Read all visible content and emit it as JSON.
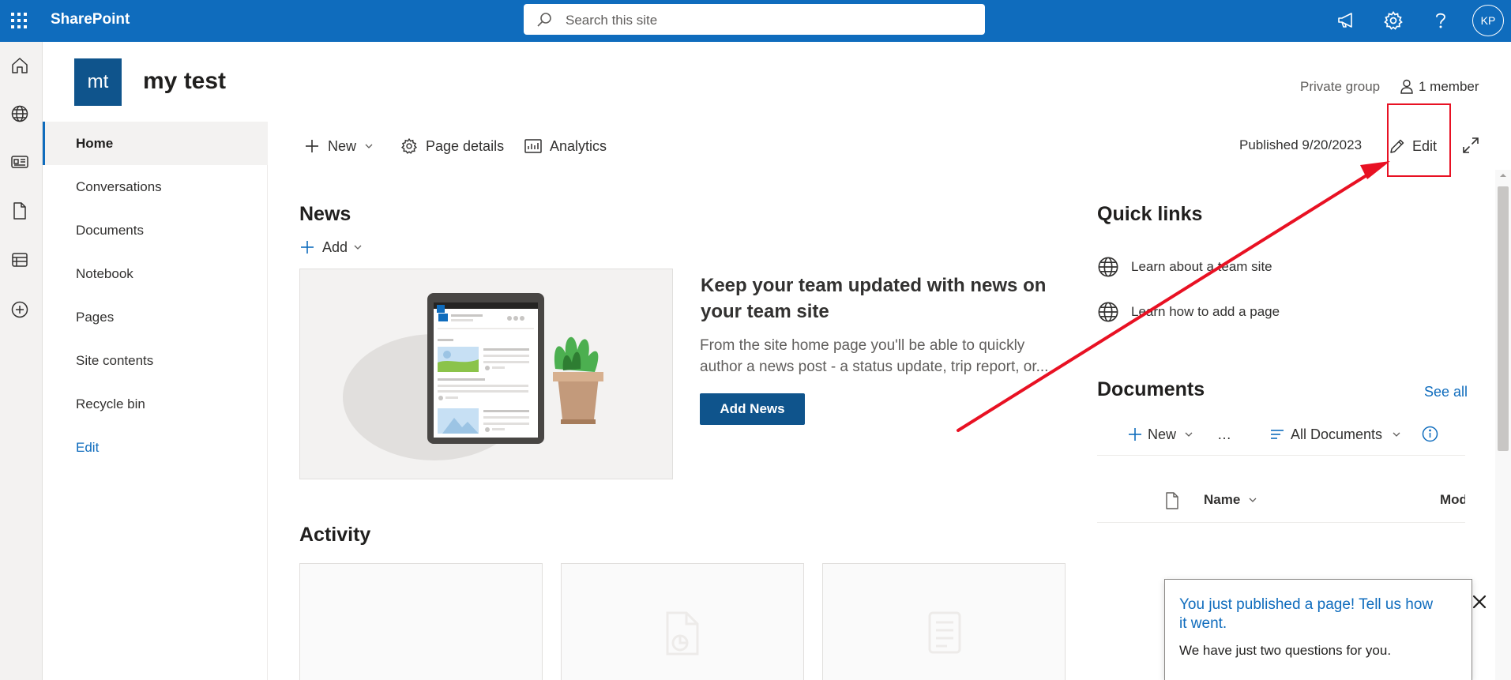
{
  "suite_bar": {
    "app_name": "SharePoint",
    "search_placeholder": "Search this site",
    "avatar_initials": "KP",
    "icons": [
      "app-launcher-icon",
      "announcement-icon",
      "settings-icon",
      "help-icon"
    ]
  },
  "app_rail": {
    "icons": [
      "home-icon",
      "globe-icon",
      "news-icon",
      "document-icon",
      "lists-icon",
      "create-icon"
    ]
  },
  "site_header": {
    "logo_initials": "mt",
    "title": "my test",
    "privacy": "Private group",
    "members": "1 member"
  },
  "left_nav": {
    "items": [
      {
        "label": "Home",
        "selected": true
      },
      {
        "label": "Conversations"
      },
      {
        "label": "Documents"
      },
      {
        "label": "Notebook"
      },
      {
        "label": "Pages"
      },
      {
        "label": "Site contents"
      },
      {
        "label": "Recycle bin"
      },
      {
        "label": "Edit"
      }
    ]
  },
  "command_bar": {
    "new_label": "New",
    "page_details_label": "Page details",
    "analytics_label": "Analytics",
    "published": "Published 9/20/2023",
    "edit_label": "Edit"
  },
  "news": {
    "title": "News",
    "add_label": "Add",
    "heading": "Keep your team updated with news on your team site",
    "body_line1": "From the site home page you'll be able to quickly",
    "body_line2": "author a news post - a status update, trip report, or...",
    "button_label": "Add News"
  },
  "activity": {
    "title": "Activity"
  },
  "quick_links": {
    "title": "Quick links",
    "items": [
      {
        "label": "Learn about a team site",
        "icon": "globe-icon"
      },
      {
        "label": "Learn how to add a page",
        "icon": "globe-icon"
      }
    ]
  },
  "documents": {
    "title": "Documents",
    "see_all": "See all",
    "new_label": "New",
    "more_label": "…",
    "view_label": "All Documents",
    "columns": [
      "Name",
      "Modified"
    ]
  },
  "toast": {
    "title": "You just published a page! Tell us how it went.",
    "body": "We have just two questions for you."
  },
  "colors": {
    "suite_bar": "#0f6cbd",
    "brand_dark": "#0f548c",
    "annotation": "#e81123"
  }
}
